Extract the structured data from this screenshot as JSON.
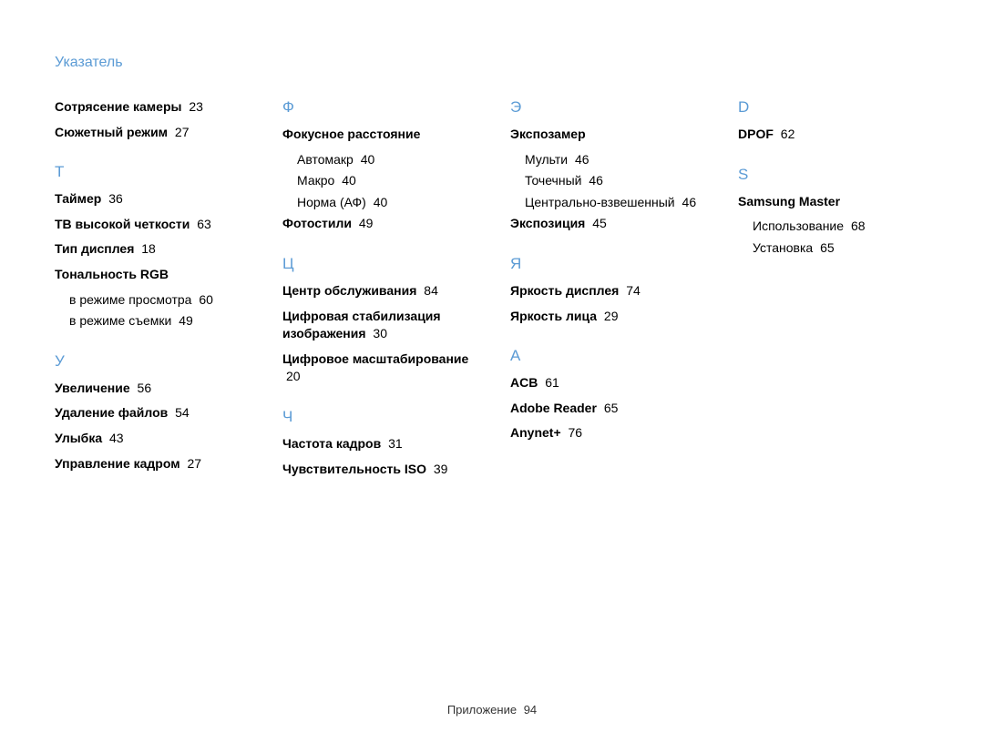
{
  "title": "Указатель",
  "footer_label": "Приложение",
  "footer_page": "94",
  "columns": [
    {
      "pre": [
        {
          "label": "Сотрясение камеры",
          "page": "23"
        },
        {
          "label": "Сюжетный режим",
          "page": "27"
        }
      ],
      "sections": [
        {
          "letter": "Т",
          "entries": [
            {
              "label": "Таймер",
              "page": "36"
            },
            {
              "label": "ТВ высокой четкости",
              "page": "63"
            },
            {
              "label": "Тип дисплея",
              "page": "18"
            },
            {
              "label": "Тональность RGB",
              "subs": [
                {
                  "label": "в режиме просмотра",
                  "page": "60"
                },
                {
                  "label": "в режиме съемки",
                  "page": "49"
                }
              ]
            }
          ]
        },
        {
          "letter": "У",
          "entries": [
            {
              "label": "Увеличение",
              "page": "56"
            },
            {
              "label": "Удаление файлов",
              "page": "54"
            },
            {
              "label": "Улыбка",
              "page": "43"
            },
            {
              "label": "Управление кадром",
              "page": "27"
            }
          ]
        }
      ]
    },
    {
      "pre": [],
      "sections": [
        {
          "letter": "Ф",
          "entries": [
            {
              "label": "Фокусное расстояние",
              "subs": [
                {
                  "label": "Автомакр",
                  "page": "40"
                },
                {
                  "label": "Макро",
                  "page": "40"
                },
                {
                  "label": "Норма (АФ)",
                  "page": "40"
                }
              ]
            },
            {
              "label": "Фотостили",
              "page": "49"
            }
          ]
        },
        {
          "letter": "Ц",
          "entries": [
            {
              "label": "Центр обслуживания",
              "page": "84"
            },
            {
              "label": "Цифровая стабилизация изображения",
              "page": "30"
            },
            {
              "label": "Цифровое масштабирование",
              "page": "20"
            }
          ]
        },
        {
          "letter": "Ч",
          "entries": [
            {
              "label": "Частота кадров",
              "page": "31"
            },
            {
              "label": "Чувствительность ISO",
              "page": "39"
            }
          ]
        }
      ]
    },
    {
      "pre": [],
      "sections": [
        {
          "letter": "Э",
          "entries": [
            {
              "label": "Экспозамер",
              "subs": [
                {
                  "label": "Мульти",
                  "page": "46"
                },
                {
                  "label": "Точечный",
                  "page": "46"
                },
                {
                  "label": "Центрально-взвешенный",
                  "page": "46"
                }
              ]
            },
            {
              "label": "Экспозиция",
              "page": "45"
            }
          ]
        },
        {
          "letter": "Я",
          "entries": [
            {
              "label": "Яркость дисплея",
              "page": "74"
            },
            {
              "label": "Яркость лица",
              "page": "29"
            }
          ]
        },
        {
          "letter": "A",
          "entries": [
            {
              "label": "ACB",
              "page": "61"
            },
            {
              "label": "Adobe Reader",
              "page": "65"
            },
            {
              "label": "Anynet+",
              "page": "76"
            }
          ]
        }
      ]
    },
    {
      "pre": [],
      "sections": [
        {
          "letter": "D",
          "entries": [
            {
              "label": "DPOF",
              "page": "62"
            }
          ]
        },
        {
          "letter": "S",
          "entries": [
            {
              "label": "Samsung Master",
              "subs": [
                {
                  "label": "Использование",
                  "page": "68"
                },
                {
                  "label": "Установка",
                  "page": "65"
                }
              ]
            }
          ]
        }
      ]
    }
  ]
}
